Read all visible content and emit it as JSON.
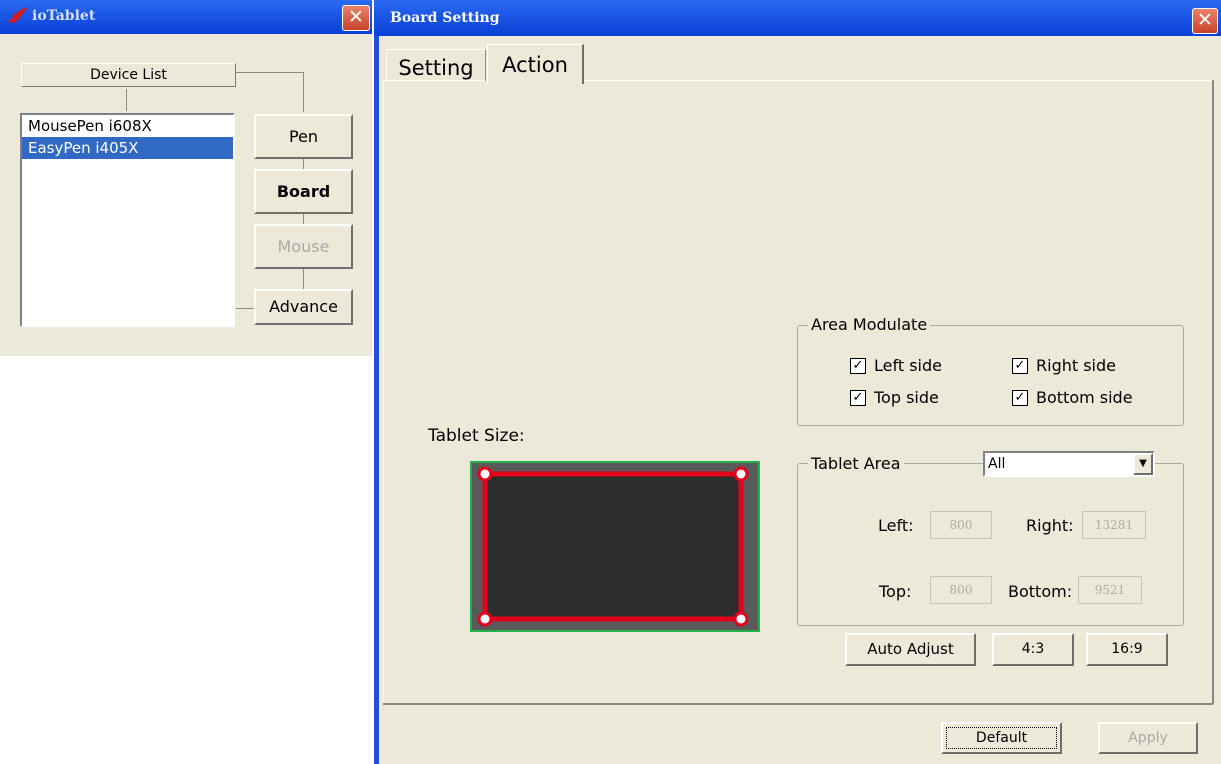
{
  "left_window": {
    "title": "ioTablet",
    "device_list_label": "Device List",
    "devices": [
      "MousePen i608X",
      "EasyPen i405X"
    ],
    "selected_device": "EasyPen i405X",
    "buttons": {
      "pen": "Pen",
      "board": "Board",
      "mouse": "Mouse",
      "advance": "Advance"
    }
  },
  "right_window": {
    "title": "Board Setting",
    "tabs": [
      "Setting",
      "Action"
    ],
    "active_tab": "Action",
    "tablet_size_label": "Tablet Size:",
    "area_modulate": {
      "label": "Area Modulate",
      "left_side": "Left side",
      "right_side": "Right side",
      "top_side": "Top side",
      "bottom_side": "Bottom side",
      "check_mark": "✓"
    },
    "tablet_area": {
      "label": "Tablet Area",
      "selected": "All",
      "left_label": "Left:",
      "left_value": "800",
      "right_label": "Right:",
      "right_value": "13281",
      "top_label": "Top:",
      "top_value": "800",
      "bottom_label": "Bottom:",
      "bottom_value": "9521"
    },
    "aspect_buttons": {
      "auto": "Auto Adjust",
      "r43": "4:3",
      "r169": "16:9"
    },
    "footer": {
      "default": "Default",
      "apply": "Apply"
    }
  },
  "colors": {
    "title_bar": "#0a3fd6",
    "selection": "#316ac5",
    "area_border": "#e3001b",
    "outer_border": "#22b14c",
    "tablet_fill": "#2e2e2e"
  },
  "icons": [
    "app-logo-icon",
    "close-icon",
    "dropdown-arrow-icon",
    "checkbox-icon",
    "handle-icon"
  ]
}
